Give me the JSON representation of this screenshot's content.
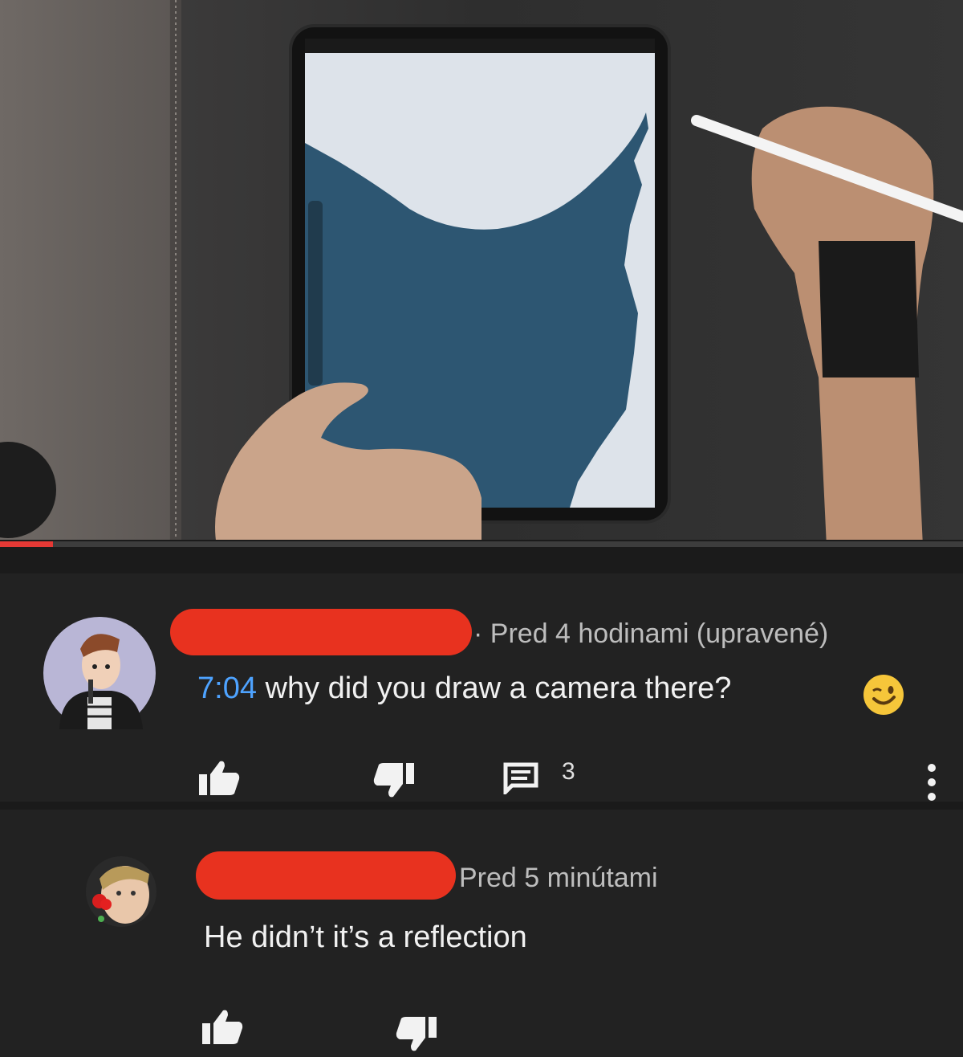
{
  "video": {
    "progress_percent": 5.5,
    "accent_color": "#e53935"
  },
  "comments": [
    {
      "author_redacted": true,
      "time": "Pred 4 hodinami (upravené)",
      "timestamp_link": "7:04",
      "text": "why did you draw a camera there?",
      "emoji": "wink-emoji",
      "reply_count": "3",
      "icons": [
        "thumbs-up-icon",
        "thumbs-down-icon",
        "comment-icon",
        "more-vertical-icon"
      ]
    },
    {
      "author_redacted": true,
      "time": "Pred 5 minútami",
      "text": "He didn’t it’s a reflection",
      "icons": [
        "thumbs-up-icon",
        "thumbs-down-icon"
      ]
    }
  ]
}
